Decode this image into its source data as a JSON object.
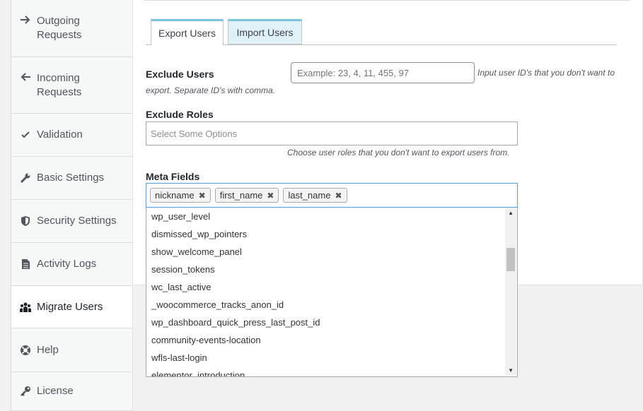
{
  "sidebar": {
    "items": [
      {
        "label": "Outgoing Requests",
        "icon": "arrow-right-icon"
      },
      {
        "label": "Incoming Requests",
        "icon": "arrow-left-icon"
      },
      {
        "label": "Validation",
        "icon": "checkmark-icon"
      },
      {
        "label": "Basic Settings",
        "icon": "wrench-icon"
      },
      {
        "label": "Security Settings",
        "icon": "shield-icon"
      },
      {
        "label": "Activity Logs",
        "icon": "document-icon"
      },
      {
        "label": "Migrate Users",
        "icon": "users-icon",
        "active": true
      },
      {
        "label": "Help",
        "icon": "lifebuoy-icon"
      },
      {
        "label": "License",
        "icon": "key-icon"
      }
    ]
  },
  "tabs": [
    {
      "label": "Export Users",
      "active": true
    },
    {
      "label": "Import Users",
      "active": false
    }
  ],
  "exclude_users": {
    "label": "Exclude Users",
    "placeholder": "Example: 23, 4, 11, 455, 97",
    "help": "Input user ID's that you don't want to export. Separate ID's with comma.",
    "help_line1": "Input user ID's that you don't want to",
    "help_line2": "export. Separate ID's with comma."
  },
  "exclude_roles": {
    "label": "Exclude Roles",
    "placeholder": "Select Some Options",
    "help": "Choose user roles that you don't want to export users from."
  },
  "meta_fields": {
    "label": "Meta Fields",
    "selected": [
      "nickname",
      "first_name",
      "last_name"
    ],
    "remove_glyph": "✖",
    "options": [
      "wp_user_level",
      "dismissed_wp_pointers",
      "show_welcome_panel",
      "session_tokens",
      "wc_last_active",
      "_woocommerce_tracks_anon_id",
      "wp_dashboard_quick_press_last_post_id",
      "community-events-location",
      "wfls-last-login",
      "elementor_introduction"
    ]
  },
  "colors": {
    "tab_accent": "#7ac6e0",
    "inactive_tab_bg": "#e0f1f8",
    "focus_border": "#5b9dd9"
  }
}
